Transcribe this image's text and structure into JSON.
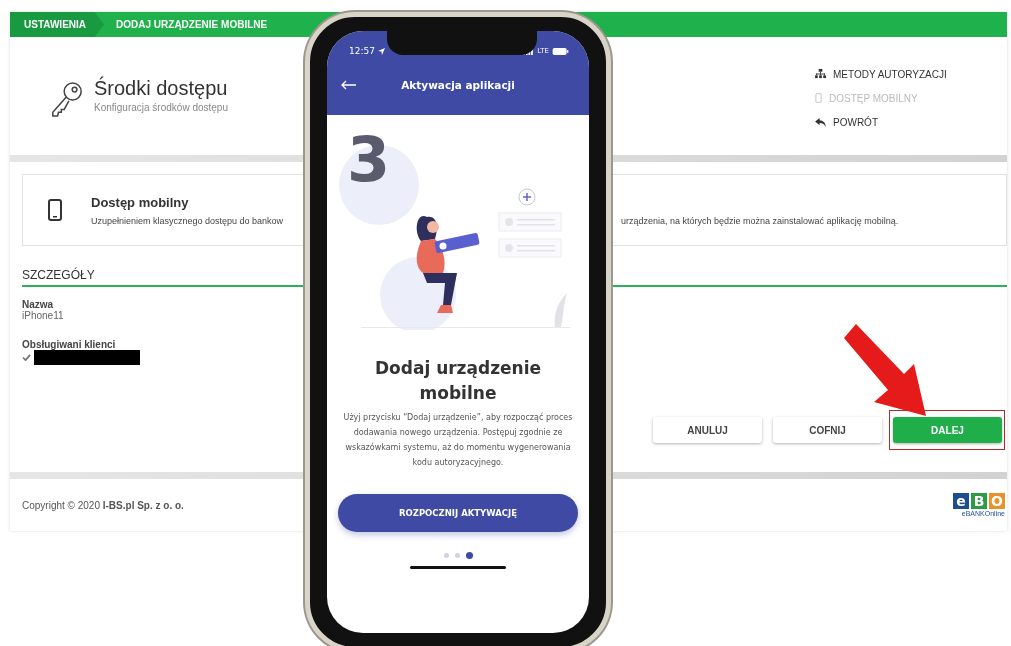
{
  "breadcrumb": [
    {
      "label": "USTAWIENIA",
      "selected": false
    },
    {
      "label": "DODAJ URZĄDZENIE MOBILNE",
      "selected": true
    }
  ],
  "header": {
    "title": "Środki dostępu",
    "subtitle": "Konfiguracja środków dostępu"
  },
  "side_links": [
    {
      "label": "METODY AUTORYZACJI",
      "kind": "sitemap",
      "disabled": false
    },
    {
      "label": "DOSTĘP MOBILNY",
      "kind": "phone",
      "disabled": true
    },
    {
      "label": "POWRÓT",
      "kind": "reply",
      "disabled": false
    }
  ],
  "info_card": {
    "title": "Dostęp mobilny",
    "description_left": "Uzupełnieniem klasycznego dostępu do bankow",
    "description_right": "urządzenia, na których będzie można zainstalować aplikację mobilną."
  },
  "details": {
    "heading": "SZCZEGÓŁY",
    "fields": [
      {
        "kind": "text",
        "label": "Nazwa",
        "value": "iPhone11"
      },
      {
        "kind": "redacted",
        "label": "Obsługiwani klienci",
        "checked": true
      }
    ]
  },
  "buttons": [
    {
      "label": "ANULUJ",
      "primary": false,
      "highlighted": false
    },
    {
      "label": "COFNIJ",
      "primary": false,
      "highlighted": false
    },
    {
      "label": "DALEJ",
      "primary": true,
      "highlighted": true
    }
  ],
  "footer": {
    "copyright": "Copyright © 2020 **I-BS.pl Sp. z o. o.**",
    "logo_letters": [
      {
        "letter": "e",
        "color": "#1d4f8f"
      },
      {
        "letter": "B",
        "color": "#2e9b47"
      },
      {
        "letter": "O",
        "color": "#e8922c"
      }
    ],
    "logo_caption": "eBANKOnline"
  },
  "phone": {
    "time": "12:57",
    "network": "LTE",
    "title": "Aktywacja aplikacji",
    "step_number": "3",
    "heading": "Dodaj urządzenie mobilne",
    "text": "Użyj przycisku “Dodaj urządzenie”, aby rozpocząć proces dodawania nowego urządzenia. Postępuj zgodnie ze wskazówkami systemu, aż do momentu wygenerowania kodu autoryzacyjnego.",
    "button": "ROZPOCZNIJ AKTYWACJĘ",
    "pager": [
      {
        "selected": false
      },
      {
        "selected": false
      },
      {
        "selected": true
      }
    ]
  }
}
